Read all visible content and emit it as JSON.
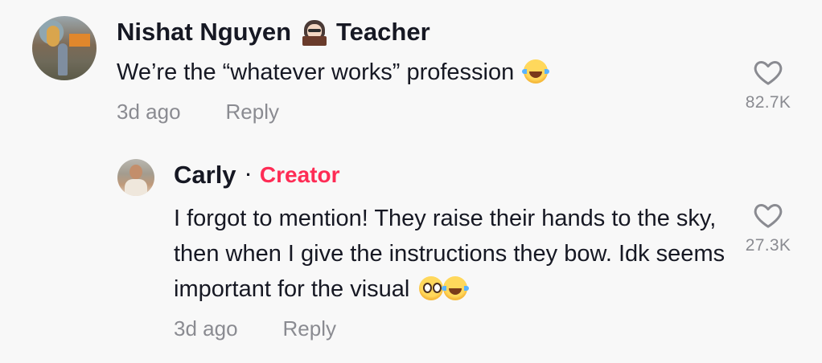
{
  "comments": [
    {
      "author": "Nishat Nguyen",
      "badge_emoji": "teacher-emoji",
      "author_suffix": "Teacher",
      "text": "We’re the “whatever works” profession",
      "emojis": [
        "laughing-tears-emoji"
      ],
      "time": "3d ago",
      "reply_label": "Reply",
      "like_count": "82.7K"
    },
    {
      "author": "Carly",
      "separator": "·",
      "role_label": "Creator",
      "text": "I forgot to mention! They raise their hands to the sky, then when I give the instructions they bow. Idk seems important for the visual",
      "emojis": [
        "flushed-emoji",
        "laughing-tears-emoji"
      ],
      "time": "3d ago",
      "reply_label": "Reply",
      "like_count": "27.3K"
    }
  ],
  "colors": {
    "background": "#f8f8f8",
    "text": "#161823",
    "muted": "#8a8b91",
    "creator": "#fe2c55"
  },
  "icons": {
    "like": "heart-outline-icon"
  }
}
